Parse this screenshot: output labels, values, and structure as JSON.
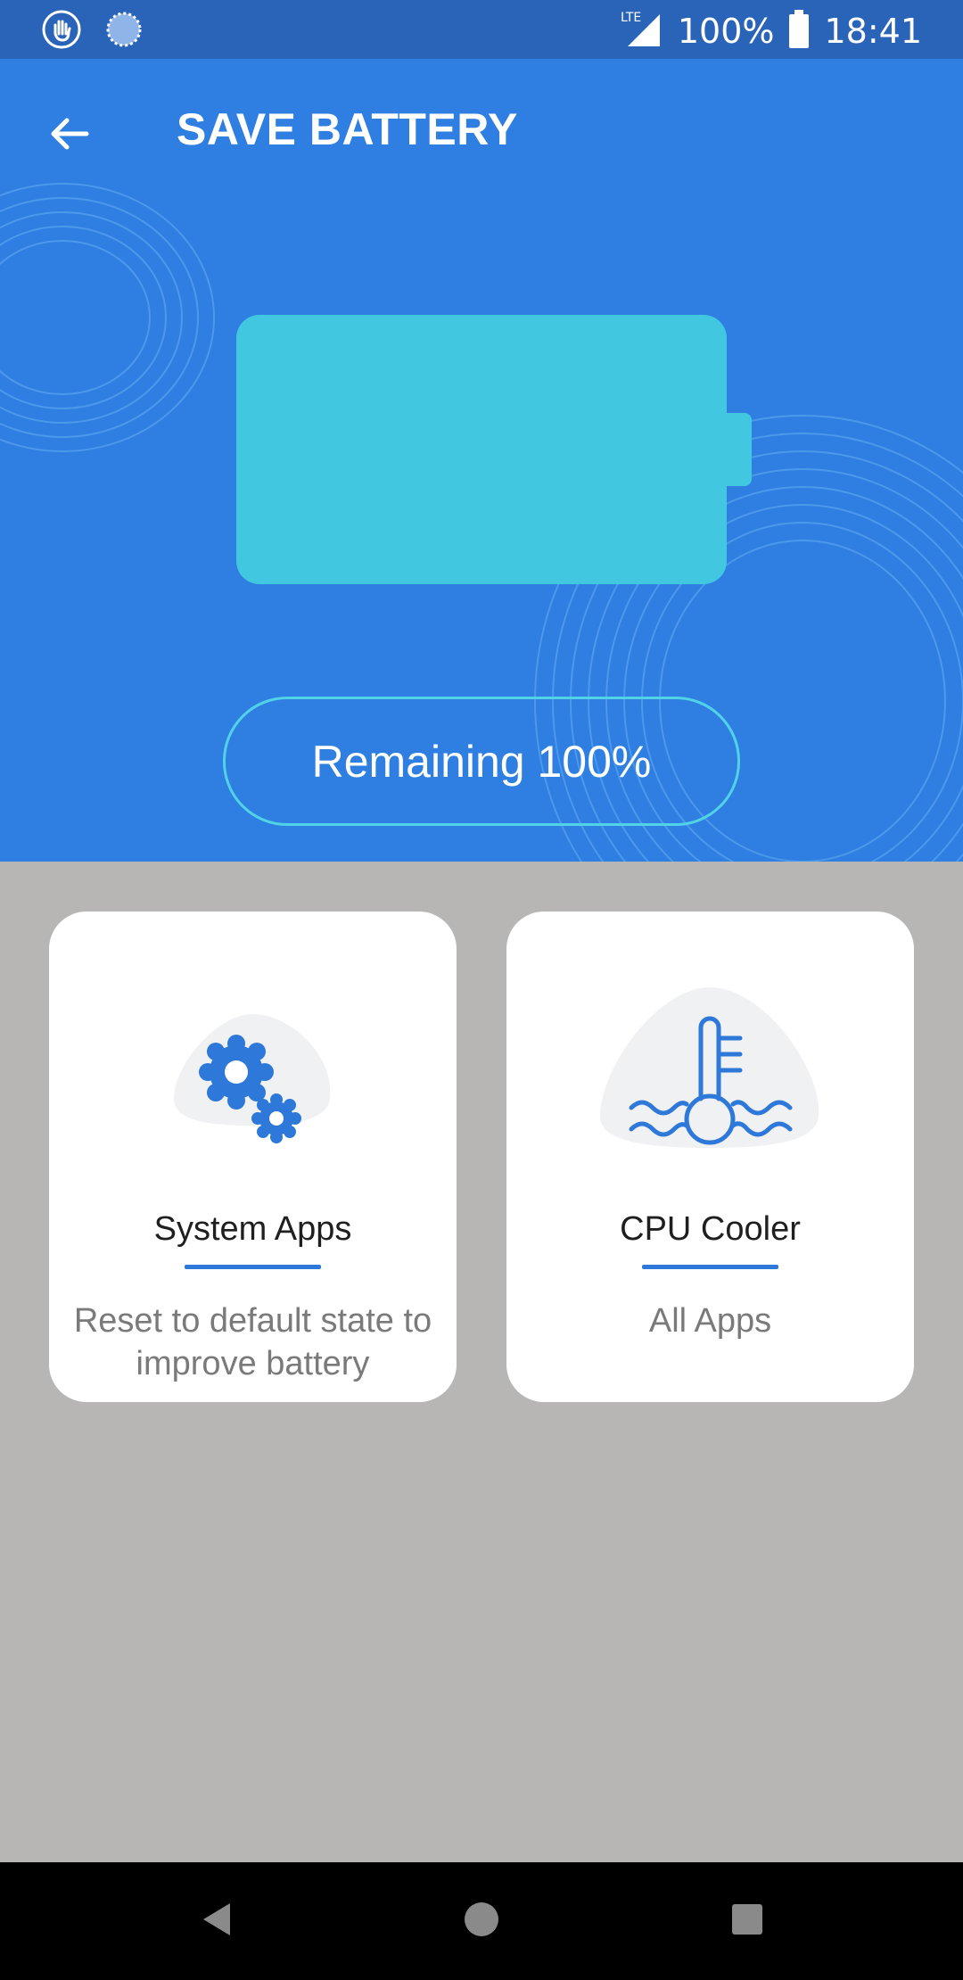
{
  "status_bar": {
    "network": "LTE",
    "battery_percent": "100%",
    "time": "18:41",
    "icons": [
      "hand-gesture-icon",
      "loading-circle-icon",
      "signal-icon",
      "battery-icon"
    ]
  },
  "header": {
    "title": "SAVE BATTERY",
    "back_icon": "arrow-left-icon"
  },
  "battery": {
    "level_percent": 100,
    "remaining_label": "Remaining 100%",
    "color": "#41c8e0"
  },
  "cards": [
    {
      "title": "System Apps",
      "description": "Reset to default state to improve battery",
      "icon": "gears-icon"
    },
    {
      "title": "CPU Cooler",
      "description": "All Apps",
      "icon": "thermometer-icon"
    }
  ],
  "nav_bar": {
    "icons": [
      "back-triangle-icon",
      "home-circle-icon",
      "recents-square-icon"
    ]
  },
  "colors": {
    "status_bar": "#2a64b8",
    "header_bg": "#2e7fe1",
    "accent": "#2d78d8",
    "page_bg": "#b7b6b5"
  }
}
